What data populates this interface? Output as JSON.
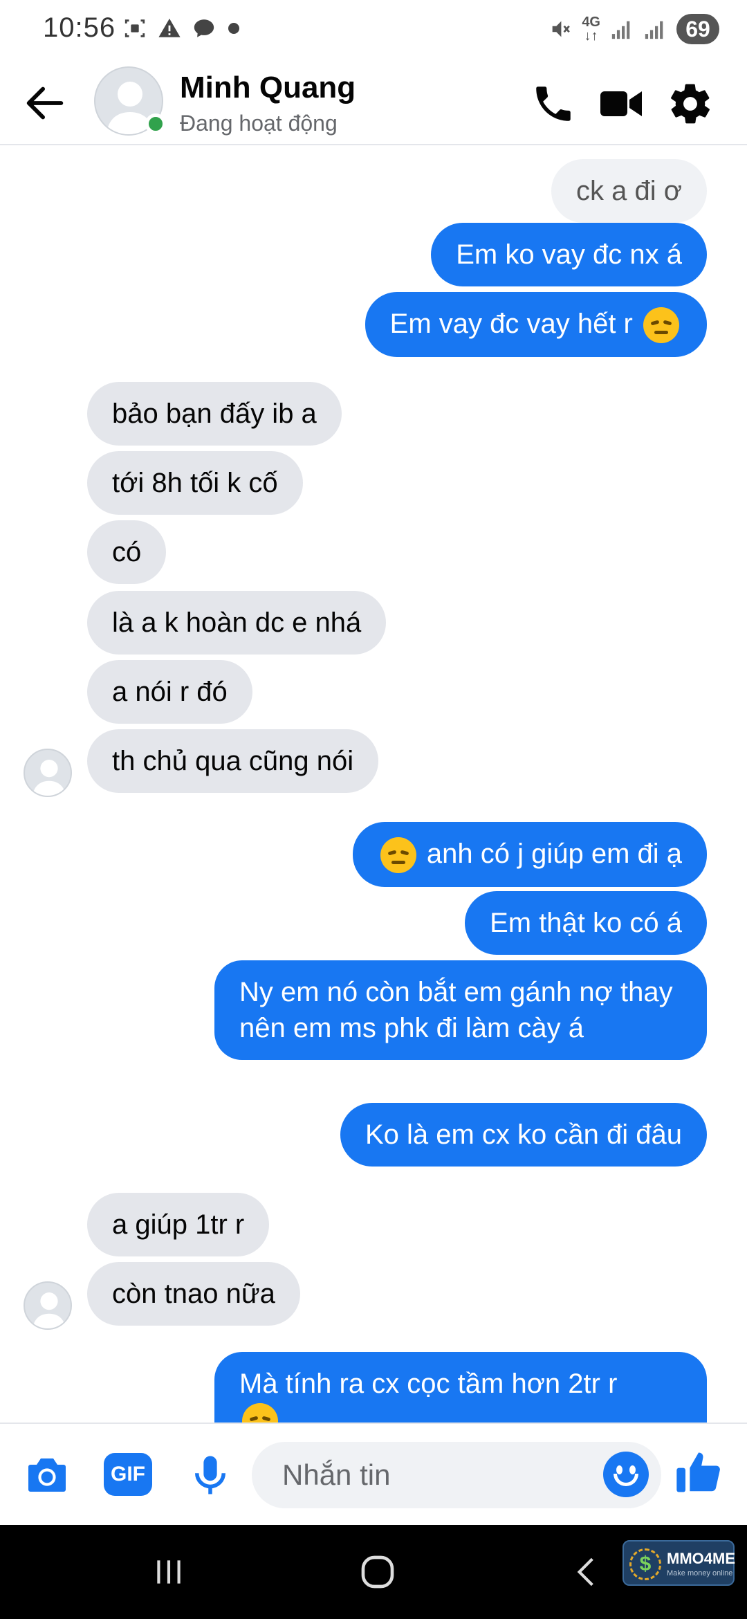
{
  "status_bar": {
    "time": "10:56",
    "network": "4G",
    "battery": "69"
  },
  "header": {
    "contact_name": "Minh Quang",
    "presence": "Đang hoạt động",
    "accent_color": "#1877f2",
    "online_color": "#31a24c"
  },
  "messages": [
    {
      "side": "out-gray",
      "text": "ck a đi ơ"
    },
    {
      "side": "out",
      "text": "Em ko vay đc nx á"
    },
    {
      "side": "out",
      "text": "Em vay đc vay hết r",
      "emoji": "pensive-face"
    },
    {
      "side": "in",
      "text": "bảo bạn đấy ib a"
    },
    {
      "side": "in",
      "text": "tới 8h tối k cố"
    },
    {
      "side": "in",
      "text": "có"
    },
    {
      "side": "in",
      "text": "là a k hoàn dc e nhá"
    },
    {
      "side": "in",
      "text": "a nói r đó"
    },
    {
      "side": "in",
      "text": "th chủ qua cũng nói"
    },
    {
      "side": "out",
      "text": "anh có j giúp em đi ạ",
      "emoji": "pensive-face"
    },
    {
      "side": "out",
      "text": "Em thật ko có á"
    },
    {
      "side": "out",
      "text": "Ny em nó còn bắt em gánh nợ thay nên em ms phk đi làm cày á"
    },
    {
      "side": "out",
      "text": "Ko là em cx ko cần đi đâu"
    },
    {
      "side": "in",
      "text": "a giúp 1tr r"
    },
    {
      "side": "in",
      "text": "còn tnao nữa"
    },
    {
      "side": "out",
      "text": "Mà tính ra cx cọc tầm hơn 2tr r",
      "emoji": "pensive-face"
    }
  ],
  "composer": {
    "gif_label": "GIF",
    "placeholder": "Nhắn tin"
  },
  "watermark": {
    "brand": "MMO4ME",
    "tagline": "Make money online",
    "coin_symbol": "$"
  }
}
